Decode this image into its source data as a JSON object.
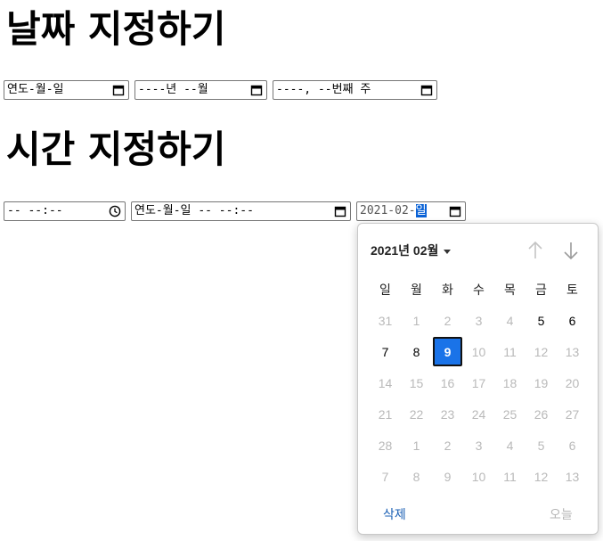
{
  "headings": {
    "date": "날짜 지정하기",
    "time": "시간 지정하기"
  },
  "inputs": {
    "date": {
      "value": "연도-월-일",
      "icon": "calendar-icon"
    },
    "month": {
      "value": "----년 --월",
      "icon": "calendar-icon"
    },
    "week": {
      "value": "----, --번째 주",
      "icon": "calendar-icon"
    },
    "time": {
      "value": "-- --:--",
      "icon": "clock-icon"
    },
    "datetime_local": {
      "value": "연도-월-일 -- --:--",
      "icon": "calendar-icon"
    },
    "active_date": {
      "value_prefix": "2021-02-",
      "value_selected": "일",
      "icon": "calendar-icon"
    }
  },
  "calendar": {
    "month_title": "2021년 02월",
    "weekdays": [
      "일",
      "월",
      "화",
      "수",
      "목",
      "금",
      "토"
    ],
    "weeks": [
      [
        {
          "d": "31",
          "s": "out"
        },
        {
          "d": "1",
          "s": "out"
        },
        {
          "d": "2",
          "s": "out"
        },
        {
          "d": "3",
          "s": "out"
        },
        {
          "d": "4",
          "s": "out"
        },
        {
          "d": "5",
          "s": "in"
        },
        {
          "d": "6",
          "s": "in"
        }
      ],
      [
        {
          "d": "7",
          "s": "in"
        },
        {
          "d": "8",
          "s": "in"
        },
        {
          "d": "9",
          "s": "sel"
        },
        {
          "d": "10",
          "s": "out"
        },
        {
          "d": "11",
          "s": "out"
        },
        {
          "d": "12",
          "s": "out"
        },
        {
          "d": "13",
          "s": "out"
        }
      ],
      [
        {
          "d": "14",
          "s": "out"
        },
        {
          "d": "15",
          "s": "out"
        },
        {
          "d": "16",
          "s": "out"
        },
        {
          "d": "17",
          "s": "out"
        },
        {
          "d": "18",
          "s": "out"
        },
        {
          "d": "19",
          "s": "out"
        },
        {
          "d": "20",
          "s": "out"
        }
      ],
      [
        {
          "d": "21",
          "s": "out"
        },
        {
          "d": "22",
          "s": "out"
        },
        {
          "d": "23",
          "s": "out"
        },
        {
          "d": "24",
          "s": "out"
        },
        {
          "d": "25",
          "s": "out"
        },
        {
          "d": "26",
          "s": "out"
        },
        {
          "d": "27",
          "s": "out"
        }
      ],
      [
        {
          "d": "28",
          "s": "out"
        },
        {
          "d": "1",
          "s": "out"
        },
        {
          "d": "2",
          "s": "out"
        },
        {
          "d": "3",
          "s": "out"
        },
        {
          "d": "4",
          "s": "out"
        },
        {
          "d": "5",
          "s": "out"
        },
        {
          "d": "6",
          "s": "out"
        }
      ],
      [
        {
          "d": "7",
          "s": "out"
        },
        {
          "d": "8",
          "s": "out"
        },
        {
          "d": "9",
          "s": "out"
        },
        {
          "d": "10",
          "s": "out"
        },
        {
          "d": "11",
          "s": "out"
        },
        {
          "d": "12",
          "s": "out"
        },
        {
          "d": "13",
          "s": "out"
        }
      ]
    ],
    "delete_label": "삭제",
    "today_label": "오늘",
    "colors": {
      "selected_bg": "#1a73e8",
      "link": "#1a5fb4",
      "disabled": "#b9b9b9"
    }
  }
}
